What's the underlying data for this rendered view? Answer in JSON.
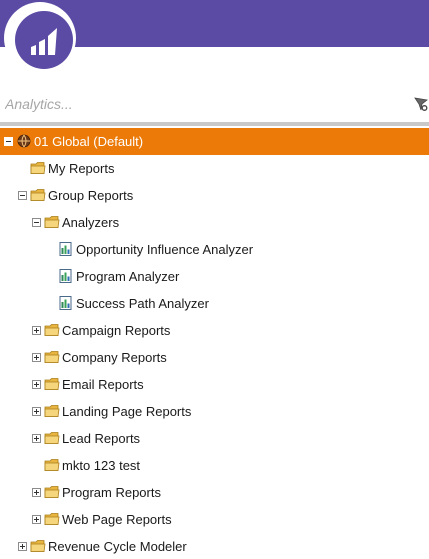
{
  "search": {
    "placeholder": "Analytics..."
  },
  "tree": {
    "root_label": "01 Global (Default)",
    "my_reports": "My Reports",
    "group_reports": "Group Reports",
    "analyzers": "Analyzers",
    "opportunity_influence_analyzer": "Opportunity Influence Analyzer",
    "program_analyzer": "Program Analyzer",
    "success_path_analyzer": "Success Path Analyzer",
    "campaign_reports": "Campaign Reports",
    "company_reports": "Company Reports",
    "email_reports": "Email Reports",
    "landing_page_reports": "Landing Page Reports",
    "lead_reports": "Lead Reports",
    "mkto_123_test": "mkto 123 test",
    "program_reports": "Program Reports",
    "web_page_reports": "Web Page Reports",
    "revenue_cycle_modeler": "Revenue Cycle Modeler"
  },
  "colors": {
    "header": "#5c4ba4",
    "selected_row": "#ec7a08",
    "folder": "#f0c55a"
  },
  "icons": {
    "logo": "marketo-logo-icon",
    "search": "search-filter-icon",
    "root": "globe-icon",
    "folder": "folder-icon",
    "report": "report-icon",
    "expand": "expand-plus-icon",
    "collapse": "collapse-minus-icon"
  }
}
